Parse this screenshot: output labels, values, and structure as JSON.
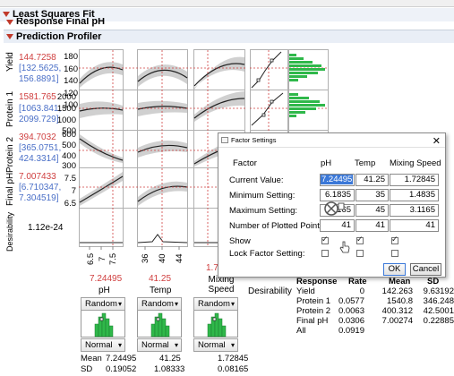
{
  "outline": {
    "least_squares_fit": "Least Squares Fit",
    "response": "Response Final pH",
    "prediction_profiler": "Prediction Profiler"
  },
  "profiler": {
    "responses": [
      {
        "label": "Yield",
        "value": "144.7258",
        "ci_low": "[132.5625,",
        "ci_high": "156.8891]",
        "ticks": [
          "180",
          "160",
          "140",
          "120",
          "100"
        ]
      },
      {
        "label": "Protein 1",
        "value": "1581.765",
        "ci_low": "[1063.841,",
        "ci_high": "2099.729]",
        "ticks": [
          "2000",
          "1500",
          "1000",
          "500"
        ]
      },
      {
        "label": "Protein 2",
        "value": "394.7032",
        "ci_low": "[365.0751,",
        "ci_high": "424.3314]",
        "ticks": [
          "600",
          "500",
          "400",
          "300"
        ]
      },
      {
        "label": "Final pH",
        "value": "7.007433",
        "ci_low": "[6.710347,",
        "ci_high": "7.304519]",
        "ticks": [
          "7.5",
          "7",
          "6.5"
        ]
      },
      {
        "label": "Desirability",
        "value": "1.12e-24",
        "ticks": [
          "1",
          "0"
        ]
      }
    ],
    "factors": [
      {
        "name": "pH",
        "current": "7.24495",
        "ticks": [
          "6.5",
          "7",
          "7.5"
        ]
      },
      {
        "name": "Temp",
        "current": "41.25",
        "ticks": [
          "36",
          "40",
          "44"
        ]
      },
      {
        "name": "Mixing\nSpeed",
        "current": "1.72",
        "ticks": []
      }
    ],
    "desirability_label": "Desirability",
    "factor_dist": [
      {
        "dist1": "Random",
        "dist2": "Normal",
        "mean_label": "Mean",
        "mean": "7.24495",
        "sd_label": "SD",
        "sd": "0.19052"
      },
      {
        "dist1": "Random",
        "dist2": "Normal",
        "mean": "41.25",
        "sd": "1.08333"
      },
      {
        "dist1": "Random",
        "dist2": "Normal",
        "mean": "1.72845",
        "sd": "0.08165"
      }
    ]
  },
  "sim_table": {
    "headers": [
      "Response",
      "Rate",
      "Mean",
      "SD"
    ],
    "rows": [
      [
        "Yield",
        "0",
        "142.263",
        "9.63192"
      ],
      [
        "Protein 1",
        "0.0577",
        "1540.8",
        "346.248"
      ],
      [
        "Protein 2",
        "0.0063",
        "400.312",
        "42.5001"
      ],
      [
        "Final pH",
        "0.0306",
        "7.00274",
        "0.22885"
      ],
      [
        "All",
        "0.0919",
        "",
        ""
      ]
    ]
  },
  "dialog": {
    "title": "Factor Settings",
    "col_factor": "Factor",
    "col_ph": "pH",
    "col_temp": "Temp",
    "col_mixing": "Mixing Speed",
    "rows": [
      {
        "label": "Current Value:",
        "values": [
          "7.24495",
          "41.25",
          "1.72845"
        ]
      },
      {
        "label": "Minimum Setting:",
        "values": [
          "6.1835",
          "35",
          "1.4835"
        ]
      },
      {
        "label": "Maximum Setting:",
        "values": [
          "8.3165",
          "45",
          "3.1165"
        ]
      },
      {
        "label": "Number of Plotted Points:",
        "values": [
          "41",
          "41",
          "41"
        ]
      }
    ],
    "show_label": "Show",
    "lock_label": "Lock Factor Setting:",
    "ok": "OK",
    "cancel": "Cancel"
  },
  "colors": {
    "accent_red": "#d04040",
    "accent_blue": "#4a6fc7",
    "histogram_green": "#2fb84a",
    "selection": "#3b78d8"
  }
}
